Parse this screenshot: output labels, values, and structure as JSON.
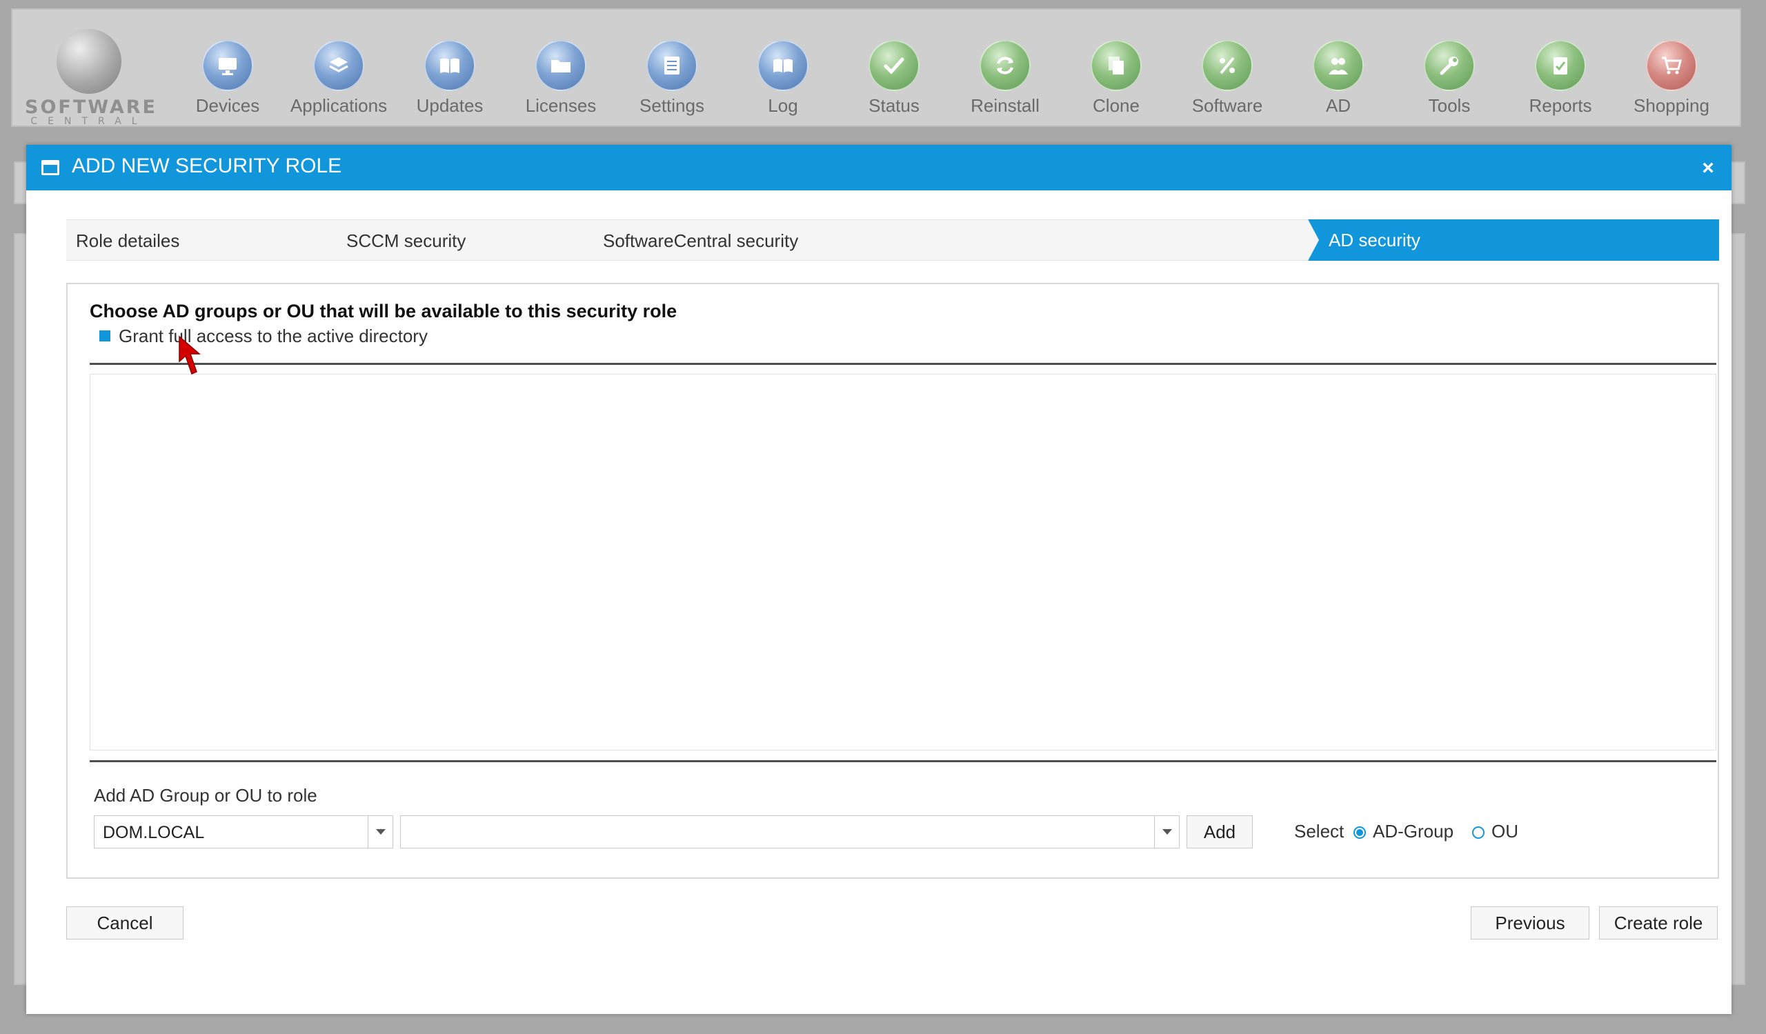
{
  "toolbar": {
    "logo": {
      "line1": "SOFTWARE",
      "line2": "CENTRAL"
    },
    "items": [
      {
        "label": "Devices",
        "icon": "monitor-icon",
        "color": "blue"
      },
      {
        "label": "Applications",
        "icon": "applications-icon",
        "color": "blue"
      },
      {
        "label": "Updates",
        "icon": "book-icon",
        "color": "blue"
      },
      {
        "label": "Licenses",
        "icon": "folder-icon",
        "color": "blue"
      },
      {
        "label": "Settings",
        "icon": "settings-form-icon",
        "color": "blue"
      },
      {
        "label": "Log",
        "icon": "log-book-icon",
        "color": "blue"
      },
      {
        "label": "Status",
        "icon": "checkmark-icon",
        "color": "green"
      },
      {
        "label": "Reinstall",
        "icon": "reinstall-icon",
        "color": "green"
      },
      {
        "label": "Clone",
        "icon": "clone-icon",
        "color": "green"
      },
      {
        "label": "Software",
        "icon": "software-icon",
        "color": "green"
      },
      {
        "label": "AD",
        "icon": "users-icon",
        "color": "green"
      },
      {
        "label": "Tools",
        "icon": "wrench-icon",
        "color": "green"
      },
      {
        "label": "Reports",
        "icon": "clipboard-check-icon",
        "color": "green"
      },
      {
        "label": "Shopping",
        "icon": "shopping-cart-icon",
        "color": "red"
      }
    ]
  },
  "dialog": {
    "title": "ADD NEW SECURITY ROLE",
    "close": "×",
    "accent_color": "#1196dc",
    "steps": [
      {
        "label": "Role detailes",
        "active": false
      },
      {
        "label": "SCCM security",
        "active": false
      },
      {
        "label": "SoftwareCentral security",
        "active": false
      },
      {
        "label": "AD security",
        "active": true
      }
    ],
    "content": {
      "heading": "Choose AD groups or OU that will be available to this security role",
      "grant_label": "Grant full access to the active directory",
      "grant_checked": true,
      "add_label": "Add AD Group or OU to role",
      "domain_value": "DOM.LOCAL",
      "group_value": "",
      "add_button": "Add",
      "select_label": "Select",
      "radio_adgroup": "AD-Group",
      "radio_ou": "OU",
      "selected_radio": "AD-Group"
    },
    "footer": {
      "cancel": "Cancel",
      "previous": "Previous",
      "create": "Create role"
    }
  }
}
